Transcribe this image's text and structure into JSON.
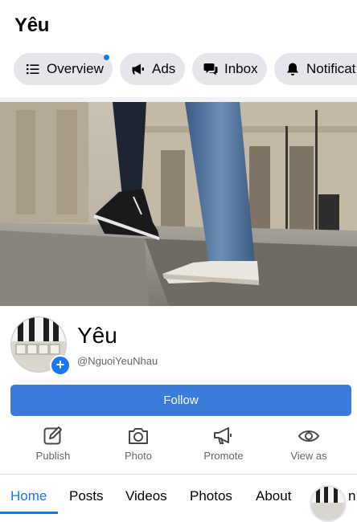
{
  "header": {
    "title": "Yêu"
  },
  "chips": [
    {
      "label": "Overview",
      "icon": "list-icon",
      "has_dot": true
    },
    {
      "label": "Ads",
      "icon": "megaphone-icon"
    },
    {
      "label": "Inbox",
      "icon": "chat-bubbles-icon"
    },
    {
      "label": "Notificat",
      "icon": "bell-icon"
    }
  ],
  "profile": {
    "name": "Yêu",
    "handle": "@NguoiYeuNhau",
    "avatar_text": "LOVE",
    "plus_symbol": "+"
  },
  "follow_label": "Follow",
  "actions": [
    {
      "label": "Publish",
      "icon": "edit-icon"
    },
    {
      "label": "Photo",
      "icon": "camera-icon"
    },
    {
      "label": "Promote",
      "icon": "megaphone-icon"
    },
    {
      "label": "View as",
      "icon": "eye-icon"
    }
  ],
  "tabs": [
    {
      "label": "Home",
      "active": true
    },
    {
      "label": "Posts"
    },
    {
      "label": "Videos"
    },
    {
      "label": "Photos"
    },
    {
      "label": "About"
    }
  ],
  "tab_partial": "n",
  "colors": {
    "accent": "#1877f2",
    "follow_button": "#3b7bdc",
    "chip_bg": "#e4e6eb",
    "muted_text": "#65676b"
  }
}
